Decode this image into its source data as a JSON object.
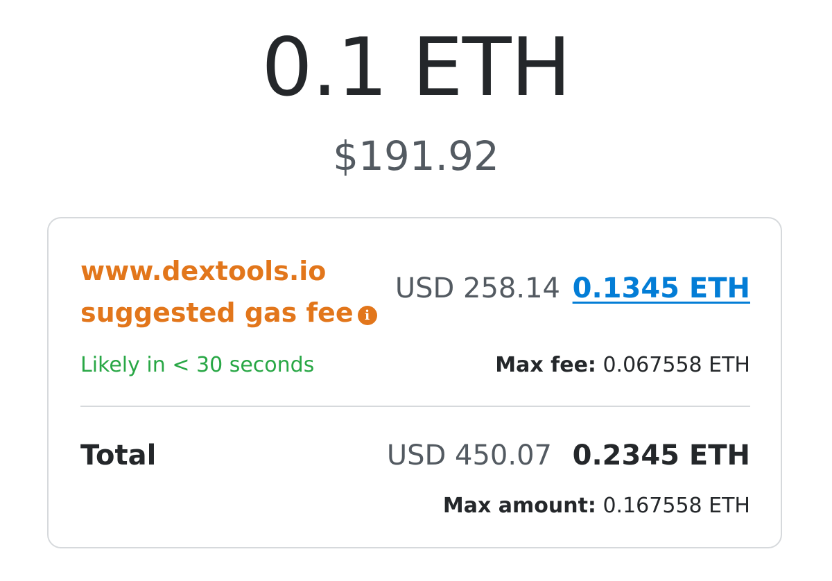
{
  "amount": {
    "value": "0.1 ETH",
    "fiat": "$191.92"
  },
  "gas": {
    "label_line1": "www.dextools.io",
    "label_line2": "suggested gas fee",
    "info_glyph": "i",
    "info_icon": "info-icon",
    "usd": "USD 258.14",
    "eth": "0.1345 ETH",
    "eta": "Likely in < 30 seconds",
    "max_fee_label": "Max fee:",
    "max_fee_value": "0.067558 ETH"
  },
  "total": {
    "label": "Total",
    "usd": "USD 450.07",
    "eth": "0.2345 ETH",
    "max_amount_label": "Max amount:",
    "max_amount_value": "0.167558 ETH"
  },
  "colors": {
    "warning_orange": "#e2761b",
    "link_blue": "#037dd6",
    "success_green": "#28a745",
    "text_dark": "#24272a",
    "text_muted": "#535a61",
    "border": "#d6d9dc"
  }
}
